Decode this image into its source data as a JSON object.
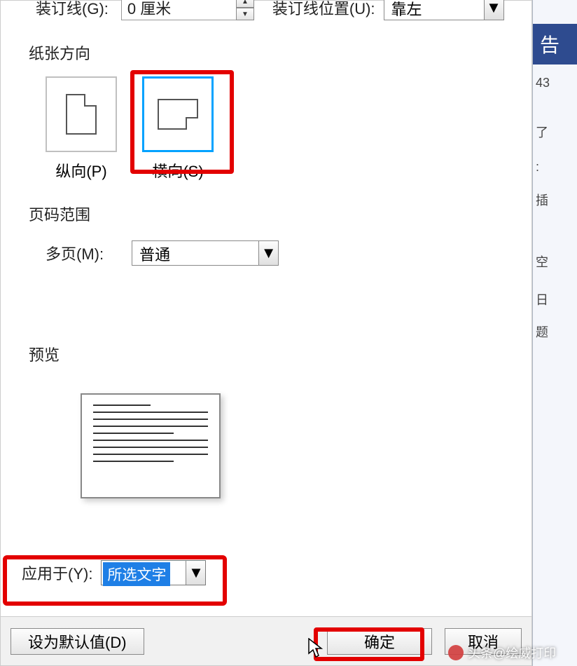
{
  "gutter": {
    "label": "装订线(G):",
    "value": "0 厘米",
    "pos_label": "装订线位置(U):",
    "pos_value": "靠左"
  },
  "orientation": {
    "title": "纸张方向",
    "portrait_label": "纵向(P)",
    "landscape_label": "横向(S)"
  },
  "page_range": {
    "title": "页码范围",
    "multipage_label": "多页(M):",
    "multipage_value": "普通"
  },
  "preview": {
    "title": "预览"
  },
  "apply": {
    "label": "应用于(Y):",
    "value": "所选文字"
  },
  "buttons": {
    "default": "设为默认值(D)",
    "ok": "确定",
    "cancel": "取消"
  },
  "sidebar": {
    "tab": "告",
    "s1": "43",
    "s2": "了",
    "s3": ":",
    "s4": "插",
    "s5": "空",
    "s6": " 日",
    "s7": "题"
  },
  "watermark": "头条@绘威打印"
}
